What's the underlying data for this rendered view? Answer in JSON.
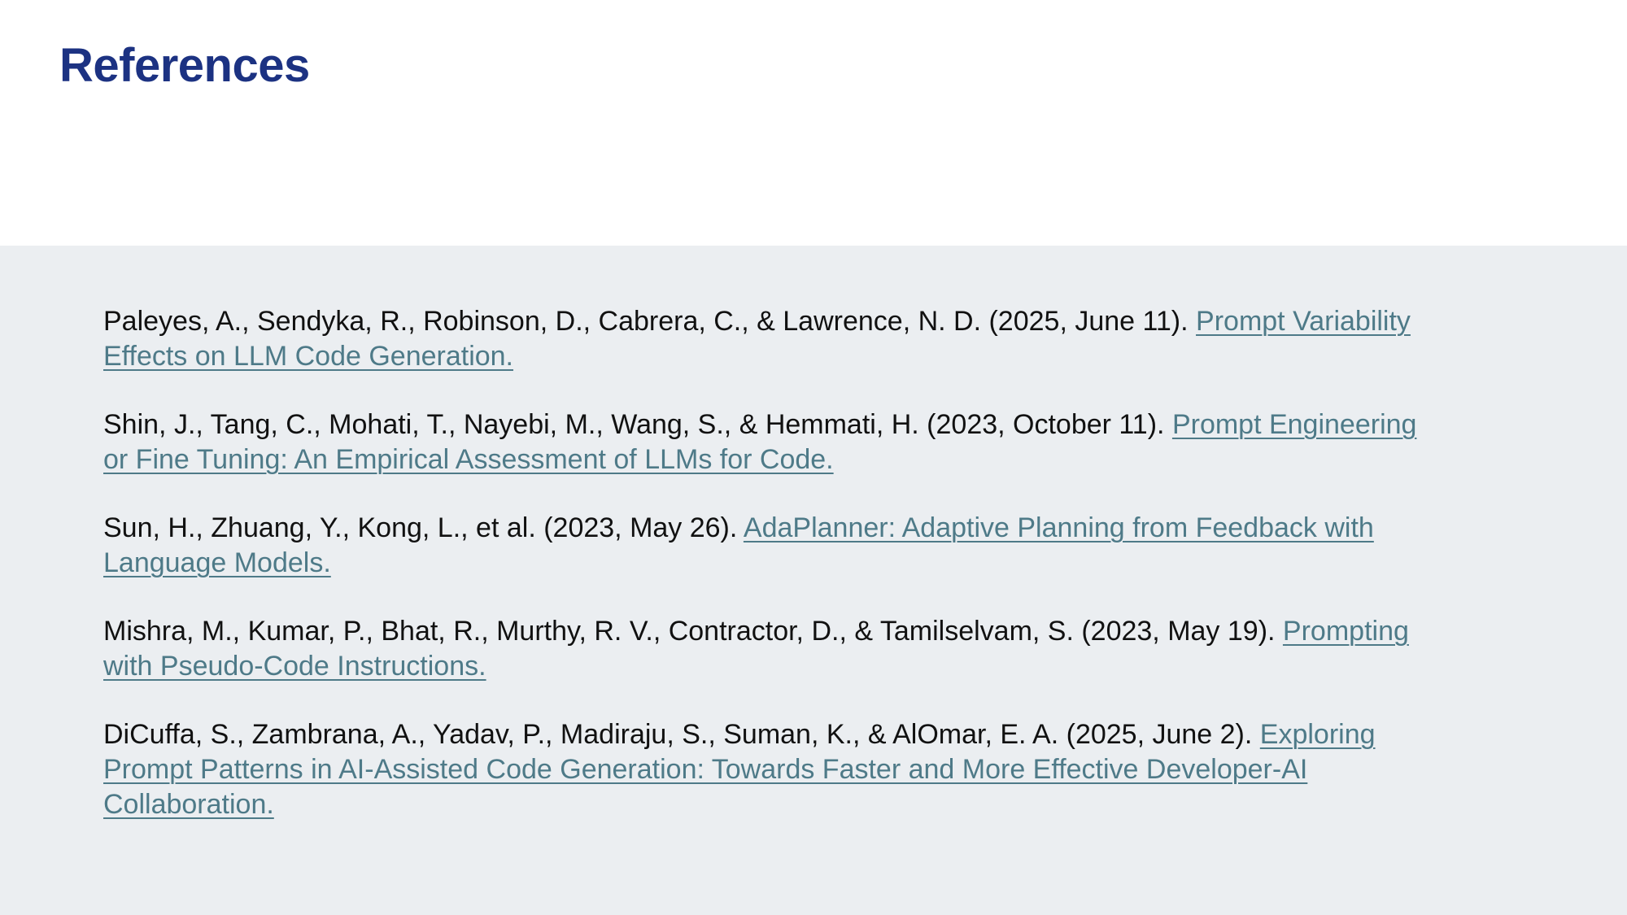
{
  "slide": {
    "title": "References"
  },
  "references": [
    {
      "citation": "Paleyes, A., Sendyka, R., Robinson, D., Cabrera, C., & Lawrence, N. D. (2025, June 11). ",
      "link_text": "Prompt Variability Effects on LLM Code Generation."
    },
    {
      "citation": "Shin, J., Tang, C., Mohati, T., Nayebi, M., Wang, S., & Hemmati, H. (2023, October 11). ",
      "link_text": "Prompt Engineering or Fine Tuning: An Empirical Assessment of LLMs for Code."
    },
    {
      "citation": "Sun, H., Zhuang, Y., Kong, L., et al. (2023, May 26). ",
      "link_text": "AdaPlanner: Adaptive Planning from Feedback with Language Models."
    },
    {
      "citation": "Mishra, M., Kumar, P., Bhat, R., Murthy, R. V., Contractor, D., & Tamilselvam, S. (2023, May 19). ",
      "link_text": "Prompting with Pseudo-Code Instructions."
    },
    {
      "citation": "DiCuffa, S., Zambrana, A., Yadav, P., Madiraju, S., Suman, K., & AlOmar, E. A. (2025, June 2). ",
      "link_text": "Exploring Prompt Patterns in AI-Assisted Code Generation: Towards Faster and More Effective Developer-AI Collaboration."
    }
  ],
  "colors": {
    "title": "#1c3282",
    "panel_background": "#ebeef1",
    "link": "#4e7a88",
    "body_text": "#111111"
  }
}
